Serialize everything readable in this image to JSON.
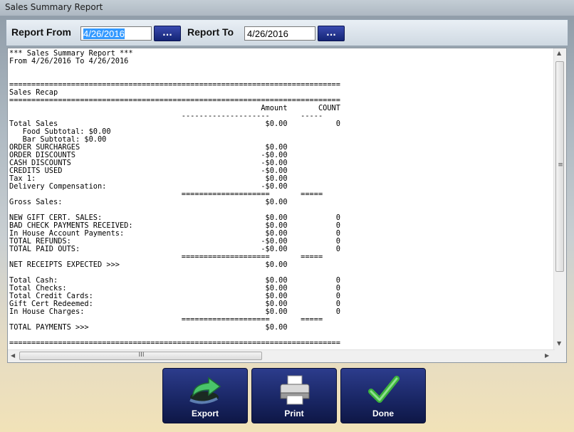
{
  "window": {
    "title": "Sales Summary Report"
  },
  "toolbar": {
    "report_from_label": "Report From",
    "report_from_value": "4/26/2016",
    "report_to_label": "Report To",
    "report_to_value": "4/26/2016",
    "picker_label": "..."
  },
  "report": {
    "lines": [
      "*** Sales Summary Report ***",
      "From 4/26/2016 To 4/26/2016",
      "",
      "",
      "===========================================================================",
      "Sales Recap",
      "===========================================================================",
      "                                                         Amount       COUNT",
      "                                       --------------------       -----",
      "Total Sales                                               $0.00           0",
      "   Food Subtotal: $0.00",
      "   Bar Subtotal: $0.00",
      "ORDER SURCHARGES                                          $0.00",
      "ORDER DISCOUNTS                                          -$0.00",
      "CASH DISCOUNTS                                           -$0.00",
      "CREDITS USED                                             -$0.00",
      "Tax 1:                                                    $0.00",
      "Delivery Compensation:                                   -$0.00",
      "                                       ====================       =====",
      "Gross Sales:                                              $0.00",
      "",
      "NEW GIFT CERT. SALES:                                     $0.00           0",
      "BAD CHECK PAYMENTS RECEIVED:                              $0.00           0",
      "In House Account Payments:                                $0.00           0",
      "TOTAL REFUNDS:                                           -$0.00           0",
      "TOTAL PAID OUTS:                                         -$0.00           0",
      "                                       ====================       =====",
      "NET RECEIPTS EXPECTED >>>                                 $0.00",
      "",
      "Total Cash:                                               $0.00           0",
      "Total Checks:                                             $0.00           0",
      "Total Credit Cards:                                       $0.00           0",
      "Gift Cert Redeemed:                                       $0.00           0",
      "In House Charges:                                         $0.00           0",
      "                                       ====================       =====",
      "TOTAL PAYMENTS >>>                                        $0.00",
      "",
      "==========================================================================="
    ]
  },
  "buttons": {
    "export": {
      "label": "Export",
      "icon": "export-arrow-icon"
    },
    "print": {
      "label": "Print",
      "icon": "printer-icon"
    },
    "done": {
      "label": "Done",
      "icon": "checkmark-icon"
    }
  },
  "scroll": {
    "vertical_grip": "≡",
    "horizontal_grip": "III"
  },
  "colors": {
    "button_bg": "#1a2766",
    "selection": "#3399ff",
    "check_green": "#3cb43c"
  }
}
